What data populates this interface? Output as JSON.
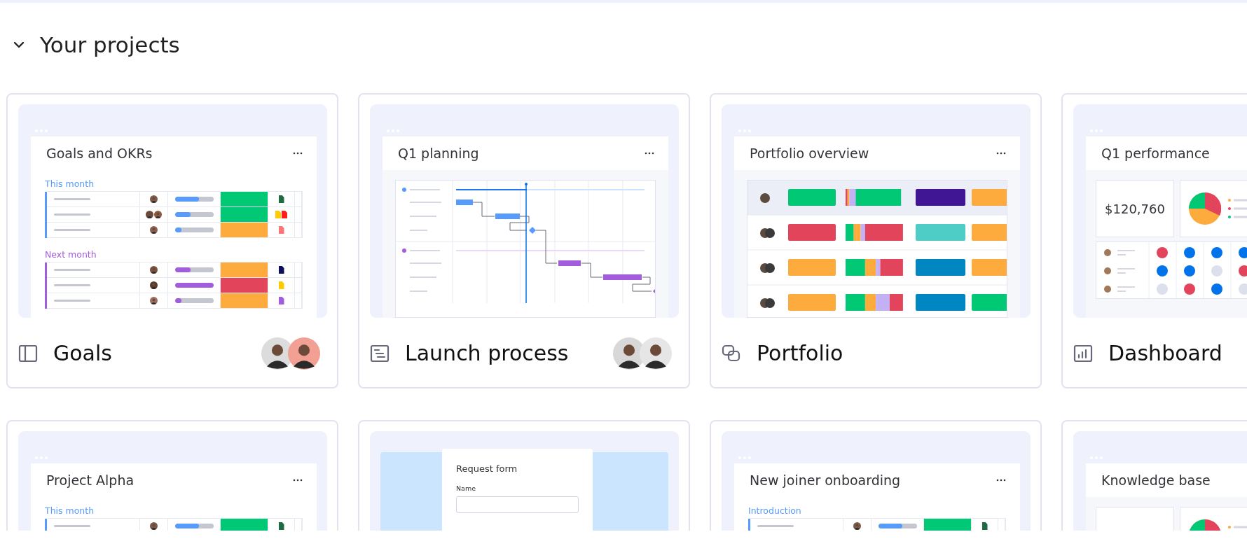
{
  "section": {
    "title": "Your projects",
    "expanded": true
  },
  "projects": [
    {
      "name": "Goals",
      "members": [
        {
          "color": "#dcdcdc"
        },
        {
          "color": "#f2a093"
        }
      ],
      "preview": {
        "kind": "table",
        "title": "Goals and OKRs",
        "groups": [
          {
            "label": "This month",
            "color": "#579bfc",
            "rows": [
              {
                "level": 0.62,
                "color": "#00c875",
                "people": [
                  {
                    "color": "#7a5a48"
                  }
                ],
                "files": [
                  {
                    "color": "#1f6b41"
                  }
                ]
              },
              {
                "level": 0.4,
                "color": "#00c875",
                "people": [
                  {
                    "color": "#6b4a3a"
                  },
                  {
                    "color": "#8a5a40"
                  }
                ],
                "files": [
                  {
                    "color": "#ffcb00"
                  },
                  {
                    "color": "#ff1d1d"
                  }
                ]
              },
              {
                "level": 0.18,
                "color": "#fdab3d",
                "people": [
                  {
                    "color": "#8b6050"
                  }
                ],
                "files": [
                  {
                    "color": "#ff7575"
                  }
                ]
              }
            ]
          },
          {
            "label": "Next month",
            "color": "#a25ddc",
            "rows": [
              {
                "level": 0.4,
                "color": "#fdab3d",
                "people": [
                  {
                    "color": "#7a5040"
                  }
                ],
                "files": [
                  {
                    "color": "#0b0f5c"
                  }
                ]
              },
              {
                "level": 1,
                "color": "#e2445c",
                "people": [
                  {
                    "color": "#5a3a2a"
                  }
                ],
                "files": [
                  {
                    "color": "#ffcb00"
                  }
                ]
              },
              {
                "level": 0.18,
                "color": "#fdab3d",
                "people": [
                  {
                    "color": "#9a7060"
                  }
                ],
                "files": [
                  {
                    "color": "#a25ddc"
                  }
                ]
              }
            ]
          }
        ]
      }
    },
    {
      "name": "Launch process",
      "members": [
        {
          "color": "#d8d8d8"
        },
        {
          "color": "#e6e6e6"
        }
      ],
      "preview": {
        "kind": "gantt",
        "title": "Q1 planning"
      }
    },
    {
      "name": "Portfolio",
      "preview": {
        "kind": "portfolio",
        "title": "Portfolio overview"
      }
    },
    {
      "name": "Dashboard",
      "preview": {
        "kind": "dashboard",
        "title": "Q1 performance",
        "total": "$120,760"
      }
    },
    {
      "preview": {
        "kind": "table",
        "title": "Project Alpha",
        "groups": [
          {
            "label": "This month",
            "color": "#579bfc",
            "rows": [
              {
                "level": 0.62,
                "color": "#00c875",
                "people": [
                  {
                    "color": "#7a5a48"
                  }
                ],
                "files": [
                  {
                    "color": "#1f6b41"
                  }
                ]
              }
            ]
          }
        ]
      }
    },
    {
      "preview": {
        "kind": "form",
        "title": "Request form",
        "field_label": "Name"
      }
    },
    {
      "preview": {
        "kind": "table",
        "title": "New joiner onboarding",
        "groups": [
          {
            "label": "Introduction",
            "color": "#579bfc",
            "rows": [
              {
                "level": 0.62,
                "color": "#00c875",
                "people": [
                  {
                    "color": "#7a5a48"
                  }
                ],
                "files": [
                  {
                    "color": "#1f6b41"
                  }
                ]
              }
            ]
          }
        ]
      }
    },
    {
      "preview": {
        "kind": "dashboard",
        "title": "Knowledge base"
      }
    }
  ]
}
